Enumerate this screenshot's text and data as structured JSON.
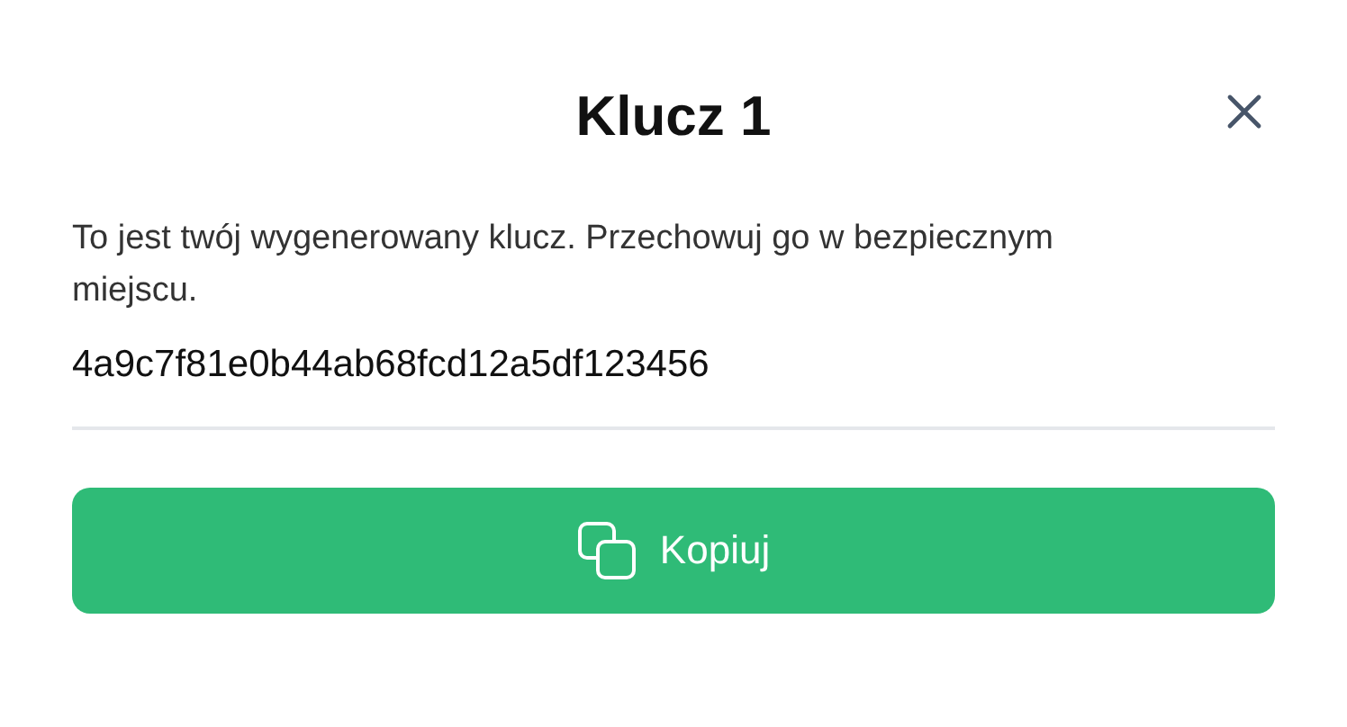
{
  "dialog": {
    "title": "Klucz 1",
    "message": "To jest twój wygenerowany klucz. Przechowuj go w bezpiecznym miejscu.",
    "key": "4a9c7f81e0b44ab68fcd12a5df123456",
    "button": "Kopiuj"
  }
}
